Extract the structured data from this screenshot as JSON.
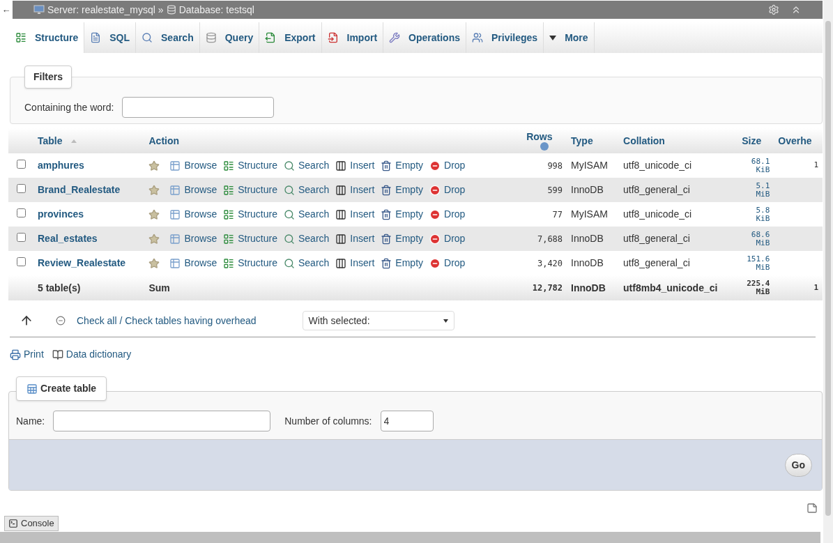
{
  "breadcrumb": {
    "back": "←",
    "server": "Server: realestate_mysql",
    "separator": "»",
    "database": "Database: testsql"
  },
  "tabs": [
    {
      "label": "Structure",
      "kind": "structure",
      "selected": true
    },
    {
      "label": "SQL",
      "kind": "sql",
      "selected": false
    },
    {
      "label": "Search",
      "kind": "search",
      "selected": false
    },
    {
      "label": "Query",
      "kind": "query",
      "selected": false
    },
    {
      "label": "Export",
      "kind": "export",
      "selected": false
    },
    {
      "label": "Import",
      "kind": "import",
      "selected": false
    },
    {
      "label": "Operations",
      "kind": "operations",
      "selected": false
    },
    {
      "label": "Privileges",
      "kind": "privileges",
      "selected": false
    },
    {
      "label": "More",
      "kind": "more",
      "selected": false
    }
  ],
  "filters": {
    "legend": "Filters",
    "label": "Containing the word:"
  },
  "table": {
    "columns": [
      "Table",
      "Action",
      "Rows",
      "Type",
      "Collation",
      "Size",
      "Overhe"
    ],
    "rows": [
      {
        "name": "amphures",
        "checked": false,
        "actions": [
          "Browse",
          "Structure",
          "Search",
          "Insert",
          "Empty",
          "Drop"
        ],
        "rows": "998",
        "type": "MyISAM",
        "collation": "utf8_unicode_ci",
        "size_value": "68.1",
        "size_unit": "KiB",
        "overhead": "1"
      },
      {
        "name": "Brand_Realestate",
        "checked": false,
        "actions": [
          "Browse",
          "Structure",
          "Search",
          "Insert",
          "Empty",
          "Drop"
        ],
        "rows": "599",
        "type": "InnoDB",
        "collation": "utf8_general_ci",
        "size_value": "5.1",
        "size_unit": "MiB"
      },
      {
        "name": "provinces",
        "checked": false,
        "actions": [
          "Browse",
          "Structure",
          "Search",
          "Insert",
          "Empty",
          "Drop"
        ],
        "rows": "77",
        "type": "MyISAM",
        "collation": "utf8_unicode_ci",
        "size_value": "5.8",
        "size_unit": "KiB"
      },
      {
        "name": "Real_estates",
        "checked": false,
        "actions": [
          "Browse",
          "Structure",
          "Search",
          "Insert",
          "Empty",
          "Drop"
        ],
        "rows": "7,688",
        "type": "InnoDB",
        "collation": "utf8_general_ci",
        "size_value": "68.6",
        "size_unit": "MiB"
      },
      {
        "name": "Review_Realestate",
        "checked": false,
        "actions": [
          "Browse",
          "Structure",
          "Search",
          "Insert",
          "Empty",
          "Drop"
        ],
        "rows": "3,420",
        "type": "InnoDB",
        "collation": "utf8_general_ci",
        "size_value": "151.6",
        "size_unit": "MiB"
      }
    ],
    "footer": {
      "label": "5 table(s)",
      "action": "Sum",
      "rows": "12,782",
      "type": "InnoDB",
      "collation": "utf8mb4_unicode_ci",
      "size_value": "225.4",
      "size_unit": "MiB",
      "overhead": "1"
    }
  },
  "bulk": {
    "check_all": "Check all / Check tables having overhead",
    "with_selected": "With selected:"
  },
  "links": [
    {
      "label": "Print",
      "kind": "print"
    },
    {
      "label": "Data dictionary",
      "kind": "dictionary"
    }
  ],
  "create": {
    "legend": "Create table",
    "name_label": "Name:",
    "columns_label": "Number of columns:",
    "columns_value": "4",
    "go": "Go"
  },
  "console": "Console"
}
